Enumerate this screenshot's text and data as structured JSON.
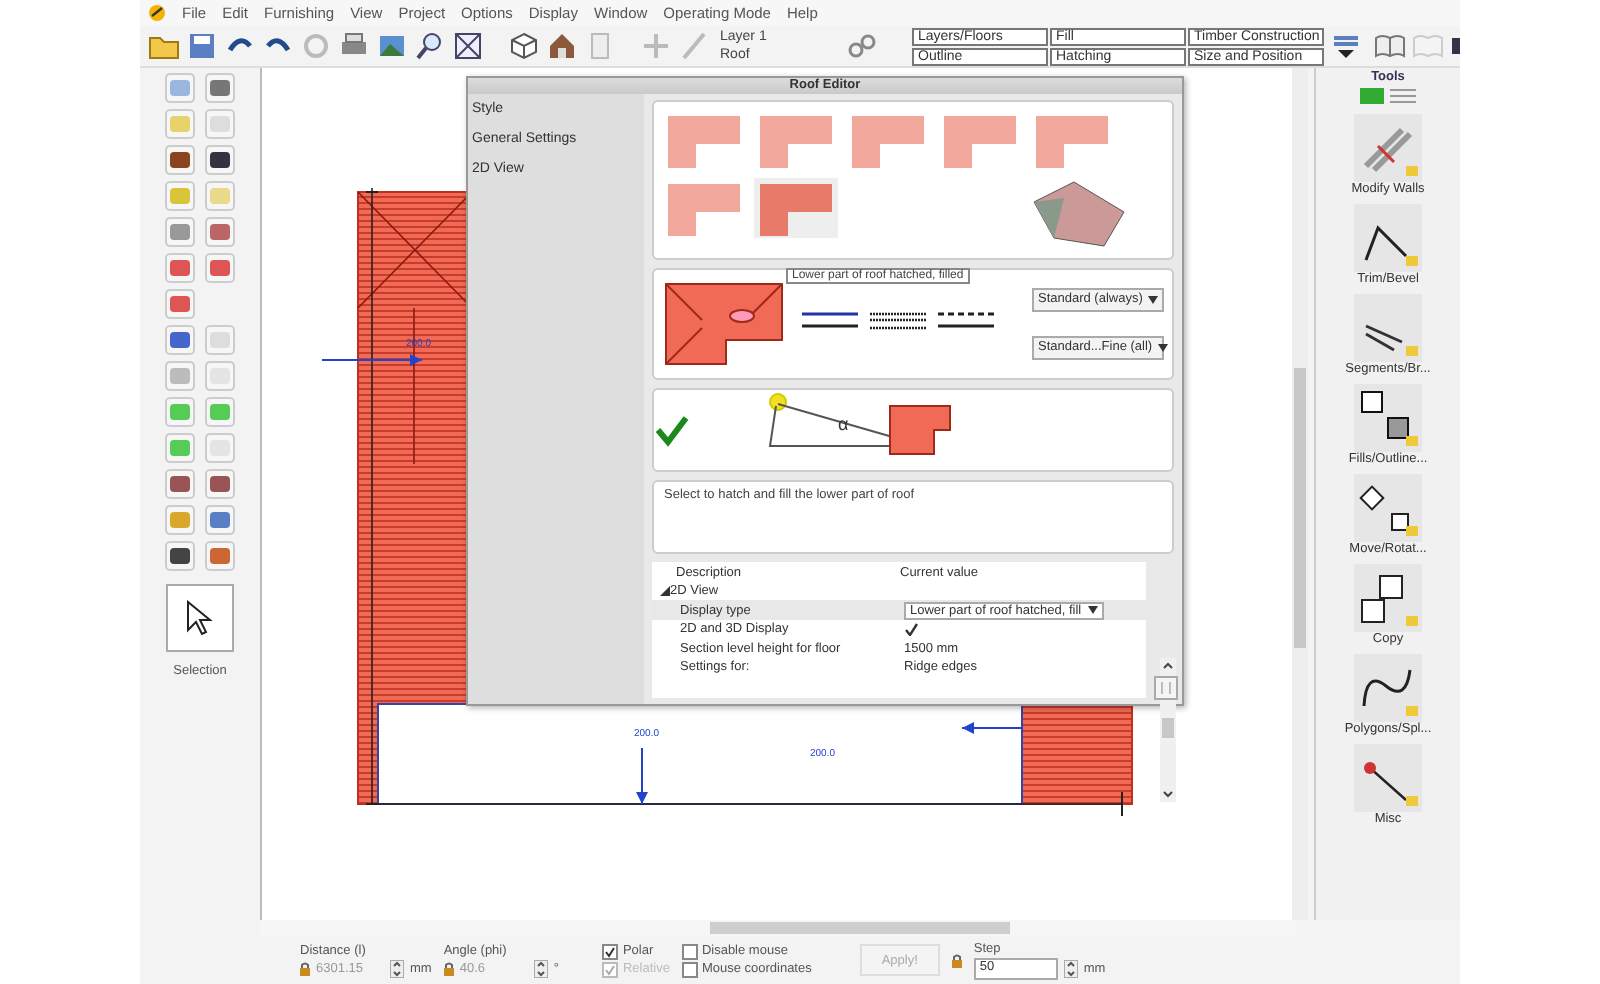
{
  "menu": [
    "File",
    "Edit",
    "Furnishing",
    "View",
    "Project",
    "Options",
    "Display",
    "Window",
    "Operating Mode",
    "Help"
  ],
  "toolbar": {
    "layer": "Layer 1",
    "element": "Roof",
    "property_buttons": [
      "Layers/Floors",
      "Fill",
      "Timber Construction",
      "Outline",
      "Hatching",
      "Size and Position"
    ]
  },
  "left_toolbar": {
    "selection_label": "Selection"
  },
  "canvas": {
    "dimension_labels": [
      "200.0",
      "200.0",
      "200.0"
    ]
  },
  "roof_editor": {
    "title": "Roof Editor",
    "nav": [
      "Style",
      "General Settings",
      "2D View"
    ],
    "tooltip": "Lower part of roof hatched, filled",
    "dropdowns": [
      "Standard (always)",
      "Standard...Fine (all)"
    ],
    "angle_symbol": "α",
    "description": "Select to hatch and fill the lower part of roof",
    "properties": {
      "columns": [
        "Description",
        "Current value"
      ],
      "group": "2D View",
      "expanded": true,
      "rows": [
        {
          "kind": "dropdown",
          "description": "Display type",
          "value": "Lower part of roof hatched, fill",
          "selected": true
        },
        {
          "kind": "check",
          "description": "2D and 3D Display",
          "checked": true,
          "selected": false
        },
        {
          "kind": "text",
          "description": "Section level height for floor",
          "value": "1500 mm",
          "selected": false
        },
        {
          "kind": "text",
          "description": "Settings for:",
          "value": "Ridge edges",
          "selected": false
        }
      ]
    }
  },
  "tools": {
    "title": "Tools",
    "items": [
      "Modify Walls",
      "Trim/Bevel",
      "Segments/Br...",
      "Fills/Outline...",
      "Move/Rotat...",
      "Copy",
      "Polygons/Spl...",
      "Misc"
    ]
  },
  "status": {
    "distance_label": "Distance (l)",
    "distance": "6301.15",
    "distance_unit": "mm",
    "angle_label": "Angle (phi)",
    "angle": "40.6",
    "angle_unit": "°",
    "checkboxes": [
      {
        "label": "Polar",
        "checked": true,
        "disabled": false
      },
      {
        "label": "Relative",
        "checked": true,
        "disabled": true
      },
      {
        "label": "Disable mouse",
        "checked": false,
        "disabled": false
      },
      {
        "label": "Mouse coordinates",
        "checked": false,
        "disabled": false
      }
    ],
    "apply": "Apply!",
    "step_label": "Step",
    "step": "50",
    "step_unit": "mm"
  }
}
